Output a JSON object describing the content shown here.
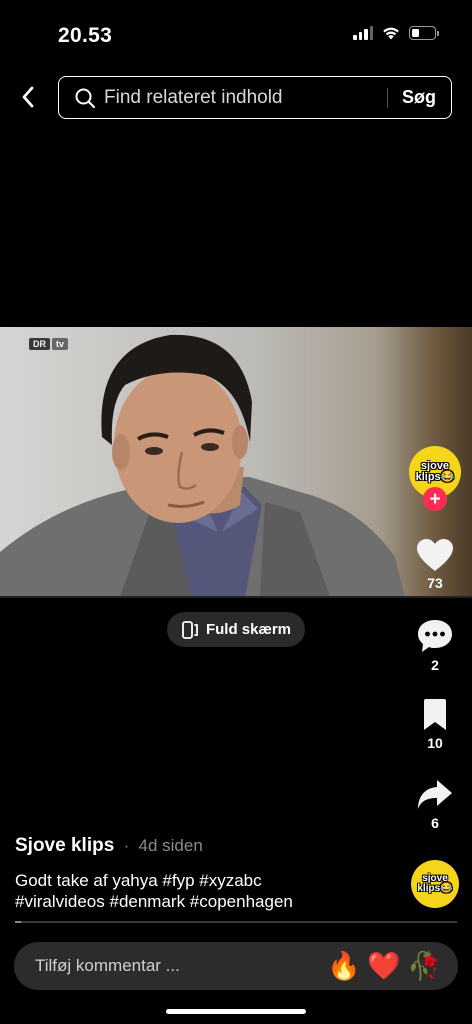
{
  "status_bar": {
    "time": "20.53",
    "icons": [
      "cellular-signal-icon",
      "wifi-icon",
      "battery-icon"
    ],
    "battery_level": 0.35
  },
  "header": {
    "back_icon": "chevron-left-icon",
    "search_icon": "search-icon",
    "search_placeholder": "Find relateret indhold",
    "search_button": "Søg"
  },
  "video": {
    "broadcaster_logo": [
      "DR",
      "tv"
    ],
    "fullscreen_label": "Fuld skærm",
    "fullscreen_icon": "rotate-fullscreen-icon"
  },
  "creator": {
    "avatar_text_line1": "sjove",
    "avatar_text_line2": "klips😂",
    "follow_icon": "plus-icon"
  },
  "actions": {
    "likes": "73",
    "comments": "2",
    "saves": "10",
    "shares": "6"
  },
  "post": {
    "author": "Sjove klips",
    "separator": "·",
    "age": "4d siden",
    "caption_line1": "Godt take af yahya #fyp #xyzabc",
    "caption_line2": "#viralvideos #denmark #copenhagen"
  },
  "comment_bar": {
    "placeholder": "Tilføj kommentar ...",
    "quick_reactions": [
      "🔥",
      "❤️",
      "🥀"
    ]
  },
  "colors": {
    "background": "#000000",
    "accent_red": "#fe2c55",
    "avatar_yellow": "#f5d51a",
    "pill_gray": "#2c2c2c"
  }
}
